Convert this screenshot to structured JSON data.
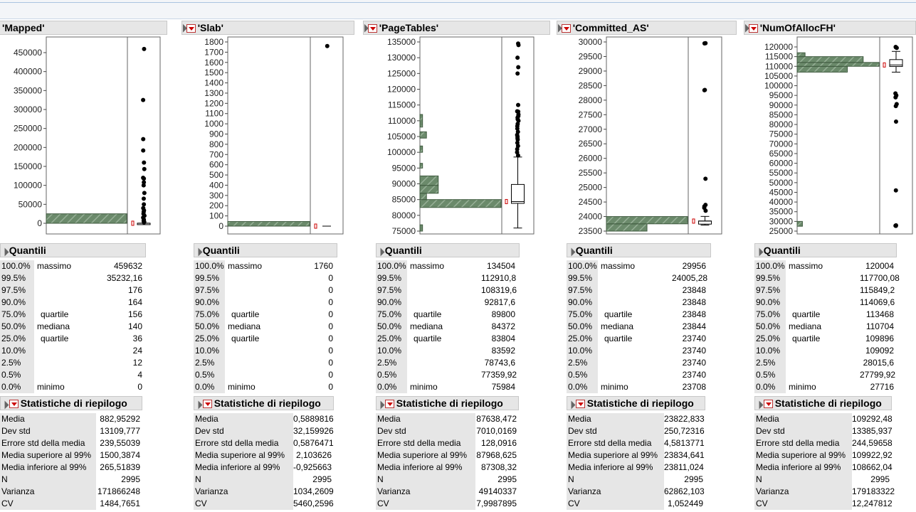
{
  "colors": {
    "bar_fill": "#6f8f6f",
    "bar_stroke": "#3f5a3f",
    "header_bg": "#e6e6e6",
    "label_bg": "#e6e6e6",
    "accent_red": "#cc0000"
  },
  "quantile_header": "Quantili",
  "summary_header": "Statistiche di riepilogo",
  "quantile_rows": [
    {
      "pct": "100.0%",
      "label": "massimo"
    },
    {
      "pct": "99.5%",
      "label": ""
    },
    {
      "pct": "97.5%",
      "label": ""
    },
    {
      "pct": "90.0%",
      "label": ""
    },
    {
      "pct": "75.0%",
      "label": "quartile"
    },
    {
      "pct": "50.0%",
      "label": "mediana"
    },
    {
      "pct": "25.0%",
      "label": "quartile"
    },
    {
      "pct": "10.0%",
      "label": ""
    },
    {
      "pct": "2.5%",
      "label": ""
    },
    {
      "pct": "0.5%",
      "label": ""
    },
    {
      "pct": "0.0%",
      "label": "minimo"
    }
  ],
  "summary_labels": [
    "Media",
    "Dev std",
    "Errore std della media",
    "Media superiore al 99%",
    "Media inferiore al 99%",
    "N",
    "Varianza",
    "CV"
  ],
  "panels": [
    {
      "title": "'Mapped'",
      "ticks": [
        "450000",
        "400000",
        "350000",
        "300000",
        "250000",
        "200000",
        "150000",
        "100000",
        "50000",
        "0"
      ],
      "quantiles": [
        "459632",
        "35232,16",
        "176",
        "164",
        "156",
        "140",
        "36",
        "24",
        "12",
        "4",
        "0"
      ],
      "summary": [
        "882,95292",
        "13109,777",
        "239,55039",
        "1500,3874",
        "265,51839",
        "2995",
        "171866248",
        "1484,7651"
      ]
    },
    {
      "title": "'Slab'",
      "ticks": [
        "1800",
        "1700",
        "1600",
        "1500",
        "1400",
        "1300",
        "1200",
        "1100",
        "1000",
        "900",
        "800",
        "700",
        "600",
        "500",
        "400",
        "300",
        "200",
        "100",
        "0"
      ],
      "quantiles": [
        "1760",
        "0",
        "0",
        "0",
        "0",
        "0",
        "0",
        "0",
        "0",
        "0",
        "0"
      ],
      "summary": [
        "0,5889816",
        "32,159926",
        "0,5876471",
        "2,103626",
        "-0,925663",
        "2995",
        "1034,2609",
        "5460,2596"
      ]
    },
    {
      "title": "'PageTables'",
      "ticks": [
        "135000",
        "130000",
        "125000",
        "120000",
        "115000",
        "110000",
        "105000",
        "100000",
        "95000",
        "90000",
        "85000",
        "80000",
        "75000"
      ],
      "quantiles": [
        "134504",
        "112910,8",
        "108319,6",
        "92817,6",
        "89800",
        "84372",
        "83804",
        "83592",
        "78743,6",
        "77359,92",
        "75984"
      ],
      "summary": [
        "87638,472",
        "7010,0169",
        "128,0916",
        "87968,625",
        "87308,32",
        "2995",
        "49140337",
        "7,9987895"
      ]
    },
    {
      "title": "'Committed_AS'",
      "ticks": [
        "30000",
        "29500",
        "29000",
        "28500",
        "28000",
        "27500",
        "27000",
        "26500",
        "26000",
        "25500",
        "25000",
        "24500",
        "24000",
        "23500"
      ],
      "quantiles": [
        "29956",
        "24005,28",
        "23848",
        "23848",
        "23848",
        "23844",
        "23740",
        "23740",
        "23740",
        "23740",
        "23708"
      ],
      "summary": [
        "23822,833",
        "250,72316",
        "4,5813771",
        "23834,641",
        "23811,024",
        "2995",
        "62862,103",
        "1,052449"
      ]
    },
    {
      "title": "'NumOfAllocFH'",
      "ticks": [
        "120000",
        "115000",
        "110000",
        "105000",
        "100000",
        "95000",
        "90000",
        "85000",
        "80000",
        "75000",
        "70000",
        "65000",
        "60000",
        "55000",
        "50000",
        "45000",
        "40000",
        "35000",
        "30000",
        "25000"
      ],
      "quantiles": [
        "120004",
        "117700,08",
        "115849,2",
        "114069,6",
        "113468",
        "110704",
        "109896",
        "109092",
        "28015,6",
        "27799,92",
        "27716"
      ],
      "summary": [
        "109292,48",
        "13385,937",
        "244,59658",
        "109922,92",
        "108662,04",
        "2995",
        "179183322",
        "12,247812"
      ]
    }
  ]
}
